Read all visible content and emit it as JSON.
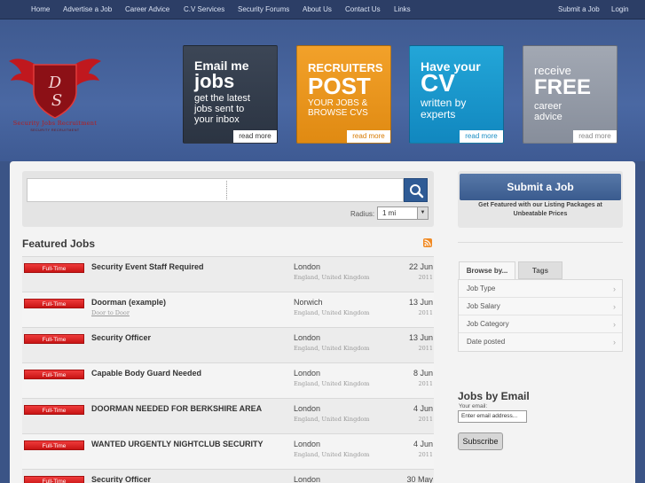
{
  "nav": {
    "home": "Home",
    "advertise": "Advertise a Job",
    "career": "Career Advice",
    "cv": "C.V Services",
    "forums": "Security Forums",
    "about": "About Us",
    "contact": "Contact Us",
    "links": "Links",
    "submit": "Submit a Job",
    "login": "Login"
  },
  "logo": {
    "text": "Security Jobs Recruitment",
    "subtext": "SECURITY RECRUITMENT"
  },
  "promos": [
    {
      "line1": "Email me",
      "line2": "jobs",
      "line3": "get the latest",
      "line4": "jobs sent to",
      "line5": "your inbox",
      "more": "read more"
    },
    {
      "line1": "RECRUITERS",
      "line2": "POST",
      "line3": "YOUR JOBS &",
      "line4": "BROWSE CVS",
      "more": "read more"
    },
    {
      "line1": "Have your",
      "line2": "CV",
      "line3": "written by",
      "line4": "experts",
      "more": "read more"
    },
    {
      "line1": "receive",
      "line2": "FREE",
      "line3": "career",
      "line4": "advice",
      "more": "read more"
    }
  ],
  "search": {
    "radius_label": "Radius:",
    "radius_value": "1 mi"
  },
  "featured": {
    "title": "Featured Jobs",
    "jobs": [
      {
        "type": "Full-Time",
        "title": "Security Event Staff Required",
        "subtitle": "",
        "city": "London",
        "region": "England, United Kingdom",
        "date": "22 Jun",
        "year": "2011"
      },
      {
        "type": "Full-Time",
        "title": "Doorman (example)",
        "subtitle": "Door to Door",
        "city": "Norwich",
        "region": "England, United Kingdom",
        "date": "13 Jun",
        "year": "2011"
      },
      {
        "type": "Full-Time",
        "title": "Security Officer",
        "subtitle": "",
        "city": "London",
        "region": "England, United Kingdom",
        "date": "13 Jun",
        "year": "2011"
      },
      {
        "type": "Full-Time",
        "title": "Capable Body Guard Needed",
        "subtitle": "",
        "city": "London",
        "region": "England, United Kingdom",
        "date": "8 Jun",
        "year": "2011"
      },
      {
        "type": "Full-Time",
        "title": "DOORMAN NEEDED FOR BERKSHIRE AREA",
        "subtitle": "",
        "city": "London",
        "region": "England, United Kingdom",
        "date": "4 Jun",
        "year": "2011"
      },
      {
        "type": "Full-Time",
        "title": "WANTED URGENTLY NIGHTCLUB SECURITY",
        "subtitle": "",
        "city": "London",
        "region": "England, United Kingdom",
        "date": "4 Jun",
        "year": "2011"
      },
      {
        "type": "Full-Time",
        "title": "Security Officer",
        "subtitle": "",
        "city": "London",
        "region": "",
        "date": "30 May",
        "year": ""
      }
    ]
  },
  "sidebar": {
    "submit_label": "Submit a Job",
    "submit_text": "Get Featured with our Listing Packages at Unbeatable Prices",
    "tab_browse": "Browse by...",
    "tab_tags": "Tags",
    "browse": [
      "Job Type",
      "Job Salary",
      "Job Category",
      "Date posted"
    ],
    "email_title": "Jobs by Email",
    "email_label": "Your email:",
    "email_value": "Enter email address...",
    "subscribe": "Subscribe"
  },
  "colors": {
    "badge": "#d42020",
    "accent": "#2f5b95",
    "promo_orange": "#e8921a",
    "promo_blue": "#1a96cf"
  }
}
